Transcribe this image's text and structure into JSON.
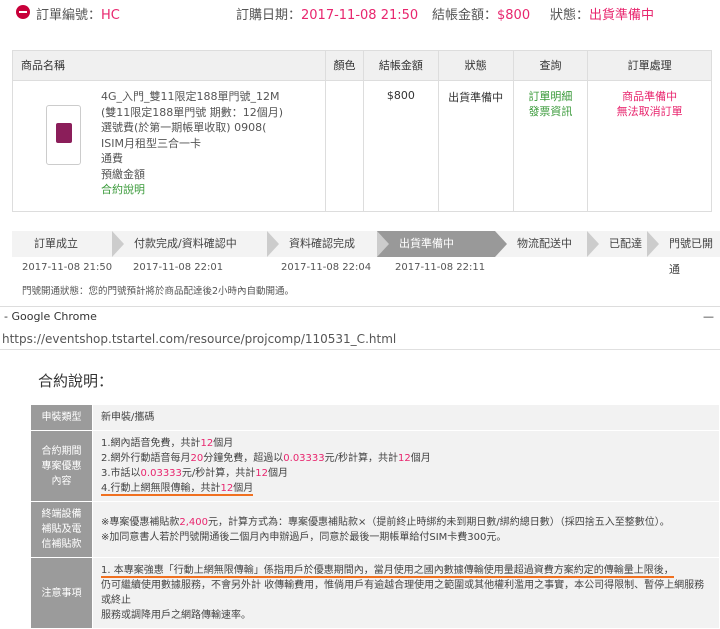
{
  "order": {
    "num_label": "訂單編號：",
    "num_value": "HC",
    "date_label": "訂購日期：",
    "date_value": "2017-11-08 21:50",
    "amount_label": "結帳金額：",
    "amount_value": "$800",
    "status_label": "狀態：",
    "status_value": "出貨準備中"
  },
  "table": {
    "headers": [
      "商品名稱",
      "顏色",
      "結帳金額",
      "狀態",
      "查詢",
      "訂單處理"
    ],
    "product_lines": [
      "4G_入門_雙11限定188單門號_12M",
      "(雙11限定188單門號 期數：12個月)",
      "選號費(於第一期帳單收取) 0908(",
      "ISIM月租型三合一卡",
      "通費",
      "預繳金額"
    ],
    "contract_link": "合約說明",
    "amount": "$800",
    "status": "出貨準備中",
    "query_links": [
      "訂單明細",
      "發票資訊"
    ],
    "actions": [
      "商品準備中",
      "無法取消訂單"
    ]
  },
  "steps": [
    "訂單成立",
    "付款完成/資料確認中",
    "資料確認完成",
    "出貨準備中",
    "物流配送中",
    "已配達",
    "門號已開通"
  ],
  "step_dates": [
    "2017-11-08 21:50",
    "2017-11-08 22:01",
    "2017-11-08 22:04",
    "2017-11-08 22:11"
  ],
  "note": "門號開通狀態：您的門號預計將於商品配達後2小時內自動開通。",
  "chrome": {
    "title": "- Google Chrome",
    "close": "—",
    "url": "https://eventshop.tstartel.com/resource/projcomp/110531_C.html"
  },
  "contract": {
    "title": "合約說明：",
    "rows": [
      {
        "label": "申裝類型",
        "value": "新申裝/攜碼"
      },
      {
        "label": "合約期間\n專案優惠\n內容",
        "lines": [
          [
            "1.網內語音免費，共計",
            "12",
            "個月",
            ""
          ],
          [
            "2.網外行動語音每月",
            "20",
            "分鐘免費，超過以",
            "0.03333",
            "元/秒計算，共計",
            "12",
            "個月"
          ],
          [
            "3.市話以",
            "0.03333",
            "元/秒計算，共計",
            "12",
            "個月"
          ],
          [
            "4.行動上網無限傳輸，共計",
            "12",
            "個月"
          ]
        ]
      },
      {
        "label": "終端設備\n補貼及電\n信補貼款",
        "line1a": "※專案優惠補貼款",
        "line1b": "2,400",
        "line1c": "元，計算方式為：專案優惠補貼款×（提前終止時綁約未到期日數/綁約總日數）（採四捨五入至整數位）。",
        "line2": "※加同意書人若於門號開通後二個月內申辦過戶，同意於最後一期帳單給付SIM卡費300元。"
      },
      {
        "label": "注意事項",
        "note_a": "1. 本專案強惠「行動上網無限傳輸」係指用戶於優惠期間內，",
        "note_b": "當月使用之國內數據傳輸使用量超過資費方案約定的傳輸量上限後，",
        "note_c": "仍可繼續使用數據服務，不會另外計 收傳輸費用，惟倘用戶有逾越合理使用之範圍或其他權利濫用之事實，本公司得限制、暫停上網服務或終止",
        "note_d": "服務或調降用戶之網路傳輸速率。"
      }
    ]
  },
  "colors": {
    "accent": "#e8266e",
    "link_green": "#3a9a3a",
    "label_bg": "#9b9b9b",
    "underline": "#f07020"
  }
}
